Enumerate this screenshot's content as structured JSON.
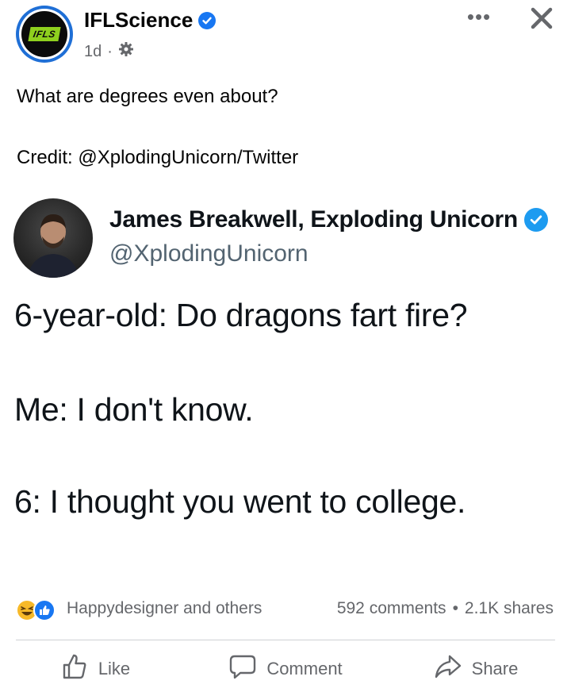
{
  "post": {
    "page_name": "IFLScience",
    "logo_text": "IFLS",
    "age": "1d",
    "separator": "·",
    "more_label": "•••",
    "caption_line1": "What are degrees even about?",
    "caption_line2": "Credit: @XplodingUnicorn/Twitter"
  },
  "tweet": {
    "author_name": "James Breakwell, Exploding Unicorn",
    "handle": "@XplodingUnicorn",
    "lines": [
      "6-year-old: Do dragons fart fire?",
      "Me: I don't know.",
      "6: I thought you went to college."
    ]
  },
  "stats": {
    "reactors": "Happydesigner and others",
    "comments": "592 comments",
    "dot": "•",
    "shares": "2.1K shares"
  },
  "actions": {
    "like": "Like",
    "comment": "Comment",
    "share": "Share"
  },
  "icons": {
    "verified": "verified-badge-icon",
    "gear": "gear-icon",
    "close": "close-icon",
    "like": "thumbs-up-icon",
    "comment": "speech-bubble-icon",
    "share": "share-arrow-icon",
    "haha": "laugh-reaction-icon"
  },
  "colors": {
    "facebook_blue": "#1877f2",
    "twitter_blue": "#1d9bf0",
    "secondary_text": "#65676b",
    "logo_green": "#8fd11e"
  }
}
